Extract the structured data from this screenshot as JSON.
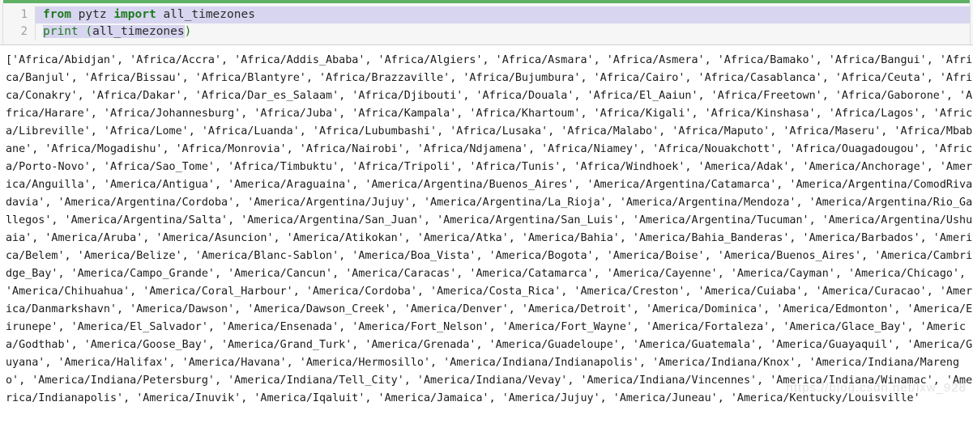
{
  "code_block": {
    "language_accent_color": "#5eb165",
    "highlight_color": "#d7d5ef",
    "keyword_color": "#1f7a1f",
    "lines": [
      {
        "number": "1",
        "tokens": [
          {
            "text": "from",
            "kind": "keyword"
          },
          {
            "text": " ",
            "kind": "plain"
          },
          {
            "text": "pytz",
            "kind": "identifier"
          },
          {
            "text": " ",
            "kind": "plain"
          },
          {
            "text": "import",
            "kind": "keyword"
          },
          {
            "text": " ",
            "kind": "plain"
          },
          {
            "text": "all_timezones",
            "kind": "identifier"
          }
        ],
        "full_text": "from pytz import all_timezones"
      },
      {
        "number": "2",
        "tokens": [
          {
            "text": "print",
            "kind": "function"
          },
          {
            "text": " ",
            "kind": "plain"
          },
          {
            "text": "(",
            "kind": "paren"
          },
          {
            "text": "all_timezones",
            "kind": "identifier"
          },
          {
            "text": ")",
            "kind": "paren"
          }
        ],
        "full_text": "print (all_timezones)"
      }
    ]
  },
  "output": {
    "text": "['Africa/Abidjan', 'Africa/Accra', 'Africa/Addis_Ababa', 'Africa/Algiers', 'Africa/Asmara', 'Africa/Asmera', 'Africa/Bamako', 'Africa/Bangui', 'Africa/Banjul', 'Africa/Bissau', 'Africa/Blantyre', 'Africa/Brazzaville', 'Africa/Bujumbura', 'Africa/Cairo', 'Africa/Casablanca', 'Africa/Ceuta', 'Africa/Conakry', 'Africa/Dakar', 'Africa/Dar_es_Salaam', 'Africa/Djibouti', 'Africa/Douala', 'Africa/El_Aaiun', 'Africa/Freetown', 'Africa/Gaborone', 'Africa/Harare', 'Africa/Johannesburg', 'Africa/Juba', 'Africa/Kampala', 'Africa/Khartoum', 'Africa/Kigali', 'Africa/Kinshasa', 'Africa/Lagos', 'Africa/Libreville', 'Africa/Lome', 'Africa/Luanda', 'Africa/Lubumbashi', 'Africa/Lusaka', 'Africa/Malabo', 'Africa/Maputo', 'Africa/Maseru', 'Africa/Mbabane', 'Africa/Mogadishu', 'Africa/Monrovia', 'Africa/Nairobi', 'Africa/Ndjamena', 'Africa/Niamey', 'Africa/Nouakchott', 'Africa/Ouagadougou', 'Africa/Porto-Novo', 'Africa/Sao_Tome', 'Africa/Timbuktu', 'Africa/Tripoli', 'Africa/Tunis', 'Africa/Windhoek', 'America/Adak', 'America/Anchorage', 'America/Anguilla', 'America/Antigua', 'America/Araguaina', 'America/Argentina/Buenos_Aires', 'America/Argentina/Catamarca', 'America/Argentina/ComodRivadavia', 'America/Argentina/Cordoba', 'America/Argentina/Jujuy', 'America/Argentina/La_Rioja', 'America/Argentina/Mendoza', 'America/Argentina/Rio_Gallegos', 'America/Argentina/Salta', 'America/Argentina/San_Juan', 'America/Argentina/San_Luis', 'America/Argentina/Tucuman', 'America/Argentina/Ushuaia', 'America/Aruba', 'America/Asuncion', 'America/Atikokan', 'America/Atka', 'America/Bahia', 'America/Bahia_Banderas', 'America/Barbados', 'America/Belem', 'America/Belize', 'America/Blanc-Sablon', 'America/Boa_Vista', 'America/Bogota', 'America/Boise', 'America/Buenos_Aires', 'America/Cambridge_Bay', 'America/Campo_Grande', 'America/Cancun', 'America/Caracas', 'America/Catamarca', 'America/Cayenne', 'America/Cayman', 'America/Chicago', 'America/Chihuahua', 'America/Coral_Harbour', 'America/Cordoba', 'America/Costa_Rica', 'America/Creston', 'America/Cuiaba', 'America/Curacao', 'America/Danmarkshavn', 'America/Dawson', 'America/Dawson_Creek', 'America/Denver', 'America/Detroit', 'America/Dominica', 'America/Edmonton', 'America/Eirunepe', 'America/El_Salvador', 'America/Ensenada', 'America/Fort_Nelson', 'America/Fort_Wayne', 'America/Fortaleza', 'America/Glace_Bay', 'America/Godthab', 'America/Goose_Bay', 'America/Grand_Turk', 'America/Grenada', 'America/Guadeloupe', 'America/Guatemala', 'America/Guayaquil', 'America/Guyana', 'America/Halifax', 'America/Havana', 'America/Hermosillo', 'America/Indiana/Indianapolis', 'America/Indiana/Knox', 'America/Indiana/Marengo', 'America/Indiana/Petersburg', 'America/Indiana/Tell_City', 'America/Indiana/Vevay', 'America/Indiana/Vincennes', 'America/Indiana/Winamac', 'America/Indianapolis', 'America/Inuvik', 'America/Iqaluit', 'America/Jamaica', 'America/Jujuy', 'America/Juneau', 'America/Kentucky/Louisville'"
  },
  "watermark": {
    "text": "https://blog.csdn.net/lxw_928"
  }
}
